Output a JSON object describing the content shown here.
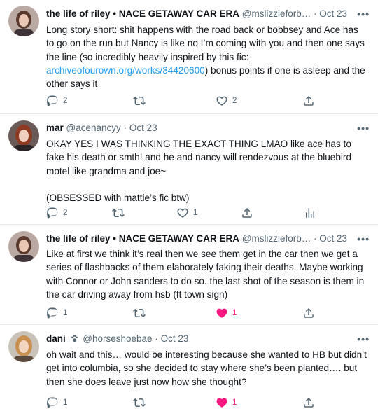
{
  "tweets": [
    {
      "name": "the life of riley • NACE GETAWAY CAR ERA",
      "handle": "@mslizzieforb…",
      "time": "Oct 23",
      "text_before": "Long story short: shit happens with the road back or bobbsey and Ace has to go on the run but Nancy is like no I’m coming with you and then one says the line (so incredibly heavily inspired by this fic: ",
      "link": "archiveofourown.org/works/34420600",
      "text_after": ") bonus points if one is asleep and the other says it",
      "reply_count": "2",
      "retweet_count": "",
      "like_count": "2",
      "liked": false
    },
    {
      "name": "mar",
      "handle": "@acenancyy",
      "time": "Oct 23",
      "text": "OKAY YES I WAS THINKING THE EXACT THING LMAO like ace has to fake his death or smth! and he and nancy will rendezvous at the bluebird motel like grandma and joe~\n\n(OBSESSED with mattie’s fic btw)",
      "reply_count": "2",
      "retweet_count": "",
      "like_count": "1",
      "liked": false
    },
    {
      "name": "the life of riley • NACE GETAWAY CAR ERA",
      "handle": "@mslizzieforb…",
      "time": "Oct 23",
      "text": "Like at first we think it’s real then we see them get in the car then we get a series of flashbacks of them elaborately faking their deaths. Maybe working with Connor or John sanders to do so. the last shot of the season is them in the car driving away from hsb (ft town sign)",
      "reply_count": "1",
      "retweet_count": "",
      "like_count": "1",
      "liked": true
    },
    {
      "name": "dani",
      "handle": "@horseshoebae",
      "time": "Oct 23",
      "text": "oh wait and this… would be interesting because she wanted to HB but didn’t get into columbia, so she decided to stay where she’s been planted…. but then she does leave just now how she thought?",
      "reply_count": "1",
      "retweet_count": "",
      "like_count": "1",
      "liked": true
    }
  ],
  "sep": "·",
  "more_glyph": "•••",
  "icons": [
    "reply-icon",
    "retweet-icon",
    "like-icon",
    "share-icon",
    "analytics-icon",
    "paw-icon",
    "more-icon"
  ],
  "colors": {
    "text": "#0f1419",
    "secondary": "#536471",
    "link": "#1d9bf0",
    "like": "#f91880"
  }
}
